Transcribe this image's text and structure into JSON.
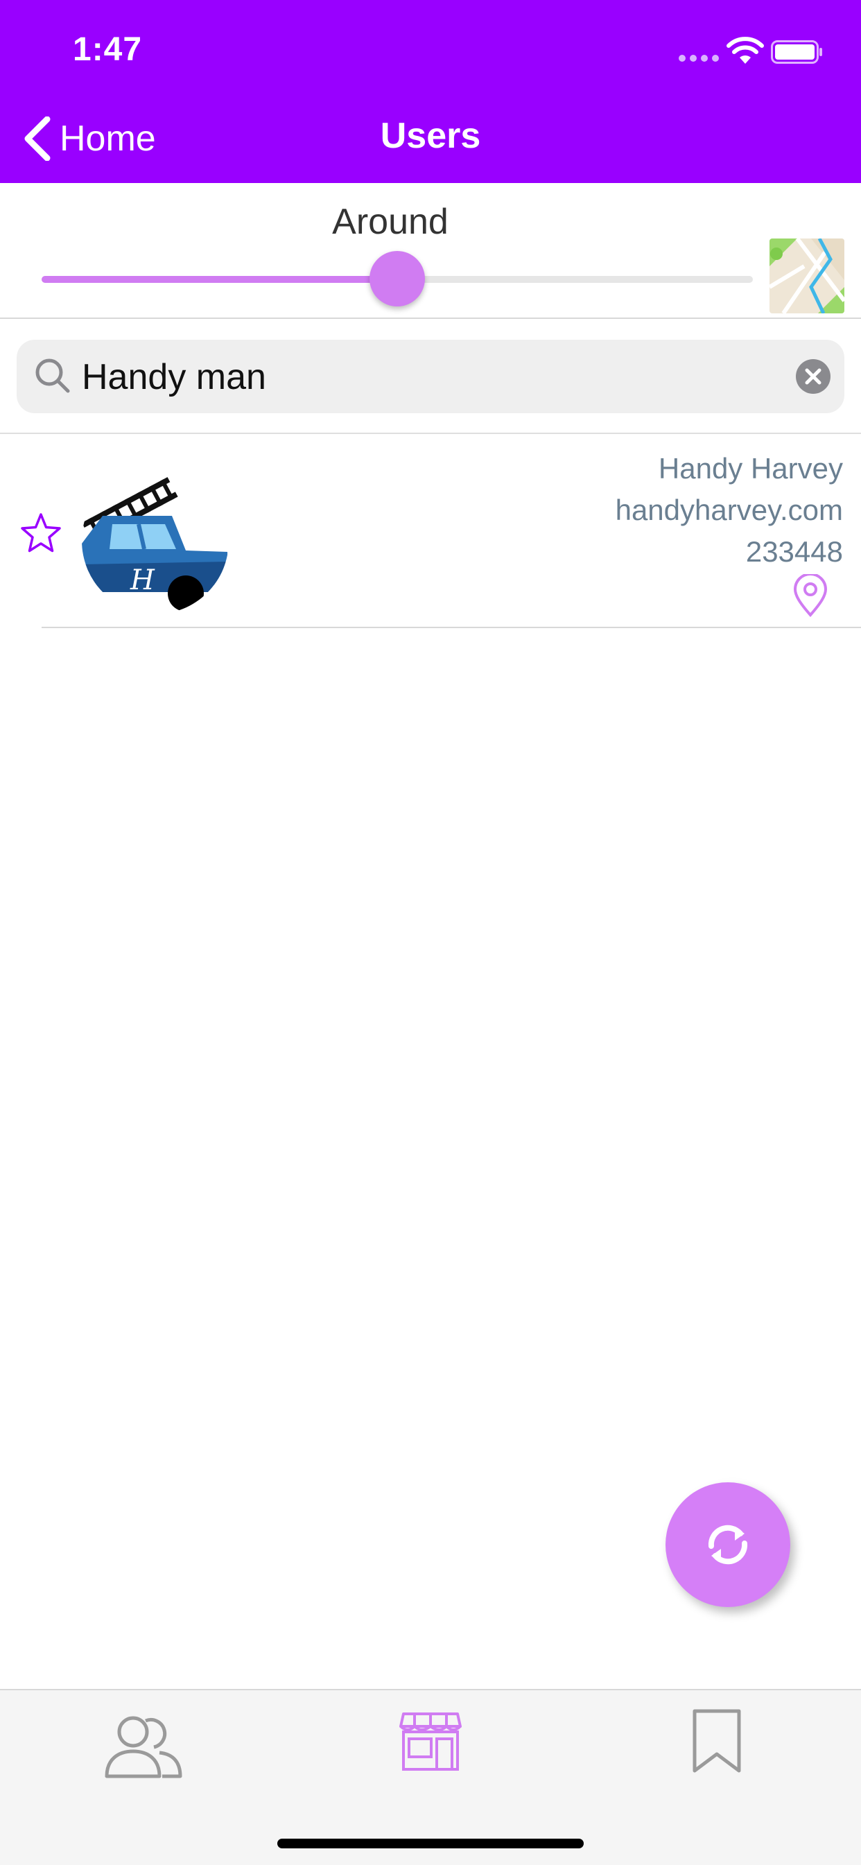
{
  "status_bar": {
    "time": "1:47"
  },
  "nav": {
    "back_label": "Home",
    "title": "Users"
  },
  "range": {
    "label": "Around",
    "value_fraction": 0.5
  },
  "search": {
    "value": "Handy man",
    "placeholder": ""
  },
  "results": [
    {
      "name": "Handy Harvey",
      "website": "handyharvey.com",
      "code": "233448"
    }
  ],
  "colors": {
    "accent": "#9900ff",
    "light_accent": "#d07cf2",
    "meta_text": "#6a7f91"
  },
  "icons": {
    "back": "chevron-left-icon",
    "map": "map-icon",
    "search": "search-icon",
    "clear": "clear-circle-icon",
    "favorite": "star-outline-icon",
    "location": "map-pin-icon",
    "refresh": "refresh-icon",
    "tab_users": "users-icon",
    "tab_shop": "storefront-icon",
    "tab_bookmark": "bookmark-icon"
  }
}
